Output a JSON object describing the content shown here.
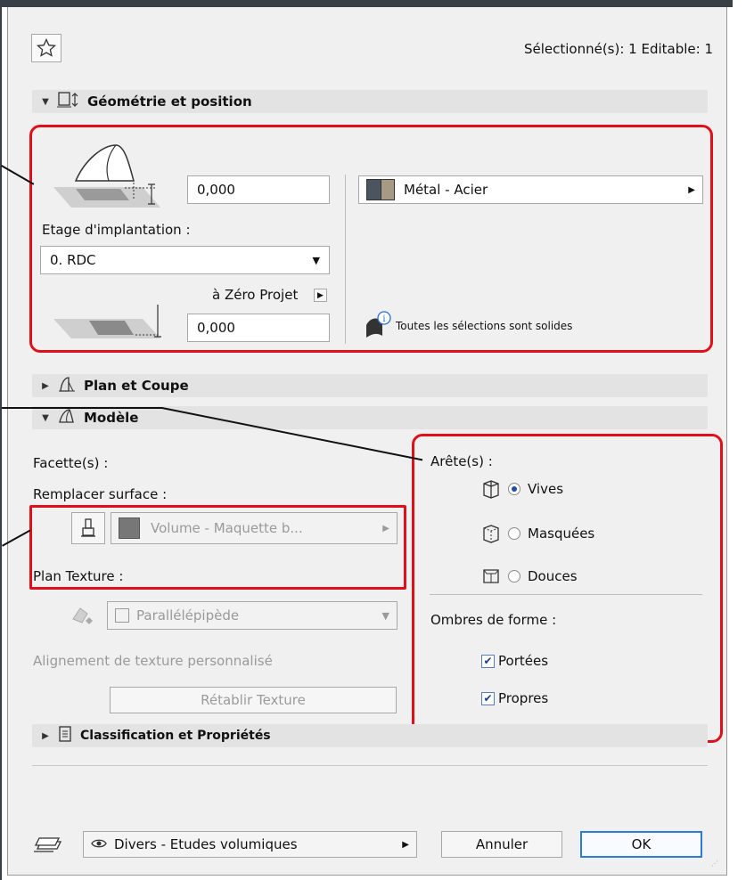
{
  "header": {
    "selection_status": "Sélectionné(s): 1 Editable: 1"
  },
  "sections": {
    "geometry": "Géométrie et position",
    "plan": "Plan et Coupe",
    "model": "Modèle",
    "classification": "Classification et Propriétés"
  },
  "geometry": {
    "top_offset_value": "0,000",
    "floor_label": "Etage d'implantation :",
    "floor_value": "0. RDC",
    "reference_label": "à Zéro Projet",
    "bottom_offset_value": "0,000",
    "material": "Métal - Acier",
    "solid_note": "Toutes les sélections sont solides"
  },
  "model": {
    "facets_label": "Facette(s) :",
    "override_label": "Remplacer surface :",
    "override_surface": "Volume - Maquette b...",
    "texture_label": "Plan Texture :",
    "texture_mode": "Parallélépipède",
    "custom_alignment": "Alignement de texture personnalisé",
    "reset_texture": "Rétablir Texture",
    "edges_label": "Arête(s) :",
    "edges": [
      {
        "label": "Vives",
        "selected": true
      },
      {
        "label": "Masquées",
        "selected": false
      },
      {
        "label": "Douces",
        "selected": false
      }
    ],
    "shadows_label": "Ombres de forme :",
    "shadows": [
      {
        "label": "Portées",
        "checked": true
      },
      {
        "label": "Propres",
        "checked": true
      }
    ]
  },
  "footer": {
    "layer": "Divers - Etudes volumiques",
    "cancel": "Annuler",
    "ok": "OK"
  },
  "colors": {
    "highlight": "#e0101a",
    "accent": "#1d4fa8",
    "section_bg": "#e3e3e3"
  }
}
